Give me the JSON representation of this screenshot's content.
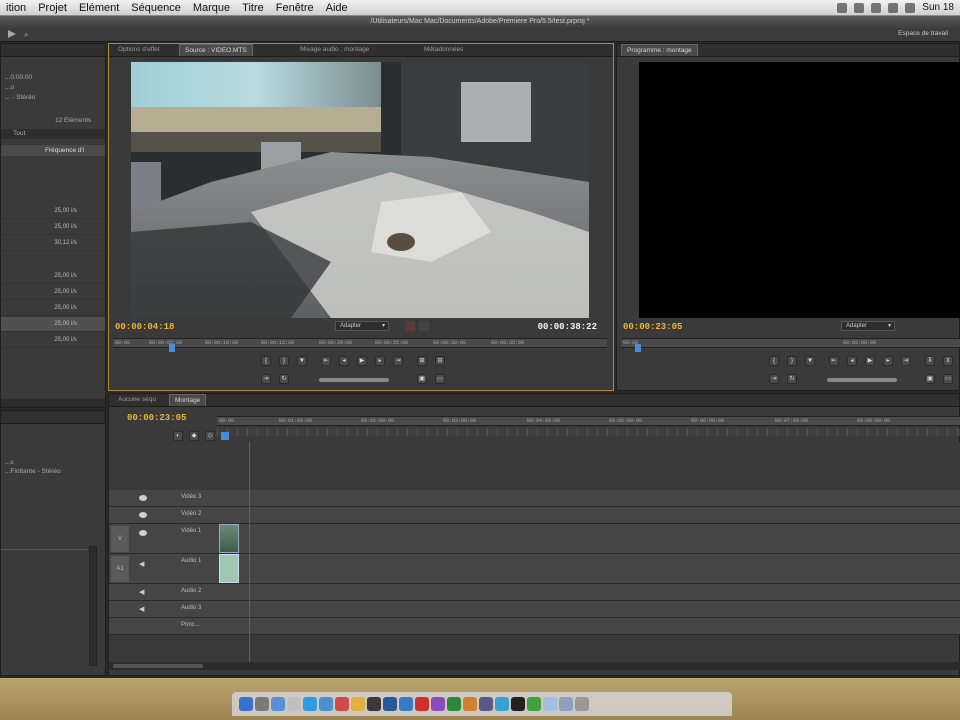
{
  "menubar": {
    "items": [
      "ition",
      "Projet",
      "Elément",
      "Séquence",
      "Marque",
      "Titre",
      "Fenêtre",
      "Aide"
    ],
    "clock": "Sun 18"
  },
  "window": {
    "title": "/Utilisateurs/Mac Mac/Documents/Adobe/Premiere Pro/5.5/test.prproj *"
  },
  "toolbar": {
    "workspace_label": "Espace de travail"
  },
  "left_panel": {
    "info_lines": [
      "...0:00:00",
      "...o",
      "... - Stéréo"
    ],
    "elements_count": "12 Eléments",
    "filter_label": "Tout",
    "column_label": "Fréquence d'i",
    "rates": [
      "25,00 i/s",
      "25,00 i/s",
      "30,12 i/s",
      "25,00 i/s",
      "25,00 i/s",
      "25,00 i/s",
      "25,00 i/s",
      "25,00 i/s"
    ],
    "lower_lines": [
      "...s",
      "...Flottante - Stéréo"
    ]
  },
  "source_panel": {
    "tabs": [
      "Options d'effet",
      "Source : VIDEO.MTS",
      "Mixage audio : montage",
      "Métadonnées"
    ],
    "timecode_in": "00:00:04:18",
    "timecode_dur": "00:00:38:22",
    "fit_label": "Adapter",
    "ruler": [
      "00:00",
      "00:00:05:00",
      "00:00:10:00",
      "00:00:15:00",
      "00:00:20:00",
      "00:00:25:00",
      "00:00:30:00",
      "00:00:35:00"
    ]
  },
  "program_panel": {
    "tab": "Programme : montage",
    "timecode": "00:00:23:05",
    "fit_label": "Adapter",
    "ruler": [
      "00:00",
      "00:05:00:00"
    ]
  },
  "timeline": {
    "tabs": [
      "Aucune séqu",
      "Montage"
    ],
    "timecode": "00:00:23:05",
    "ruler": [
      "00:00",
      "00:01:00:00",
      "00:02:00:00",
      "00:03:00:00",
      "00:04:00:00",
      "00:05:00:00",
      "00:06:00:00",
      "00:07:00:00",
      "00:08:00:00"
    ],
    "video_tracks": [
      "Vidéo 3",
      "Vidéo 2",
      "Vidéo 1"
    ],
    "audio_tracks": [
      "Audio 1",
      "Audio 2",
      "Audio 3",
      "Princ..."
    ],
    "side_labels": [
      "V",
      "A1"
    ]
  },
  "colors": {
    "accent": "#e8b43a",
    "playhead": "#c0392b",
    "panel": "#3a3a3a"
  }
}
